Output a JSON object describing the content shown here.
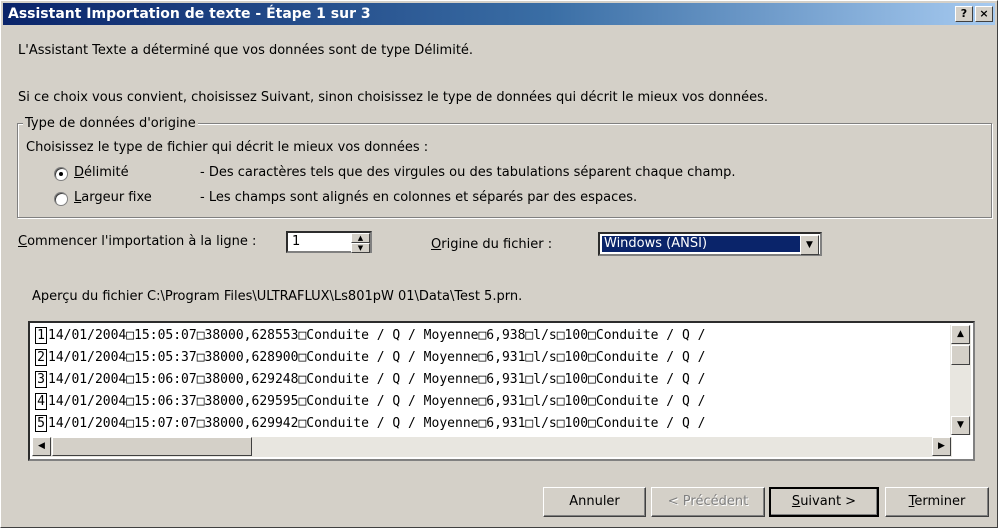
{
  "window": {
    "title": "Assistant Importation de texte - Étape 1 sur 3",
    "help_label": "?",
    "close_label": "×"
  },
  "intro": {
    "line1": "L'Assistant Texte a déterminé que vos données sont de type Délimité.",
    "line2": "Si ce choix vous convient, choisissez Suivant, sinon choisissez le type de données qui décrit le mieux vos données."
  },
  "group": {
    "legend": "Type de données d'origine",
    "prompt": "Choisissez le type de fichier qui décrit le mieux vos données :",
    "options": [
      {
        "label_pre": "",
        "label_u": "D",
        "label_post": "élimité",
        "desc": "- Des caractères tels que des virgules ou des tabulations séparent chaque champ.",
        "checked": true
      },
      {
        "label_pre": "",
        "label_u": "L",
        "label_post": "argeur fixe",
        "desc": "- Les champs sont alignés en colonnes et séparés par des espaces.",
        "checked": false
      }
    ]
  },
  "start_row": {
    "label_u": "C",
    "label_post": "ommencer l'importation à la ligne :",
    "value": "1"
  },
  "origin": {
    "label_u": "O",
    "label_post": "rigine du fichier :",
    "value": "Windows (ANSI)"
  },
  "preview": {
    "label": "Aperçu du fichier C:\\Program Files\\ULTRAFLUX\\Ls801pW 01\\Data\\Test 5.prn.",
    "rows": [
      {
        "num": "1",
        "text": "14/01/2004□15:05:07□38000,628553□Conduite / Q / Moyenne□6,938□l/s□100□Conduite / Q /"
      },
      {
        "num": "2",
        "text": "14/01/2004□15:05:37□38000,628900□Conduite / Q / Moyenne□6,931□l/s□100□Conduite / Q /"
      },
      {
        "num": "3",
        "text": "14/01/2004□15:06:07□38000,629248□Conduite / Q / Moyenne□6,931□l/s□100□Conduite / Q /"
      },
      {
        "num": "4",
        "text": "14/01/2004□15:06:37□38000,629595□Conduite / Q / Moyenne□6,931□l/s□100□Conduite / Q /"
      },
      {
        "num": "5",
        "text": "14/01/2004□15:07:07□38000,629942□Conduite / Q / Moyenne□6,931□l/s□100□Conduite / Q /"
      }
    ]
  },
  "buttons": {
    "cancel": "Annuler",
    "previous": "< Précédent",
    "next_u": "S",
    "next_post": "uivant >",
    "finish_u": "T",
    "finish_post": "erminer"
  }
}
